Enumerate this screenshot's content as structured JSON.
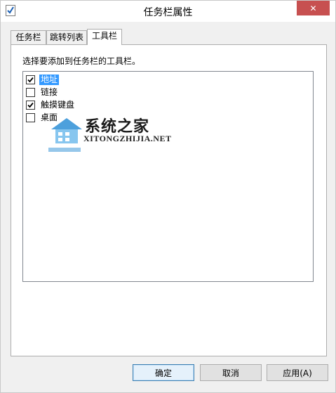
{
  "window": {
    "title": "任务栏属性",
    "close_glyph": "✕"
  },
  "tabs": [
    {
      "label": "任务栏",
      "active": false
    },
    {
      "label": "跳转列表",
      "active": false
    },
    {
      "label": "工具栏",
      "active": true
    }
  ],
  "panel": {
    "instruction": "选择要添加到任务栏的工具栏。",
    "toolbars": [
      {
        "label": "地址",
        "checked": true,
        "selected": true
      },
      {
        "label": "链接",
        "checked": false,
        "selected": false
      },
      {
        "label": "触摸键盘",
        "checked": true,
        "selected": false
      },
      {
        "label": "桌面",
        "checked": false,
        "selected": false
      }
    ]
  },
  "watermark": {
    "name": "系统之家",
    "url": "XITONGZHIJIA.NET"
  },
  "buttons": {
    "ok": "确定",
    "cancel": "取消",
    "apply": "应用(A)"
  },
  "colors": {
    "selection": "#3399ff",
    "close": "#c75050",
    "watermark_blue": "#2e8fd6"
  },
  "icons": {
    "app": "checkbox-app-icon",
    "check": "checkmark-icon",
    "close": "close-icon"
  }
}
